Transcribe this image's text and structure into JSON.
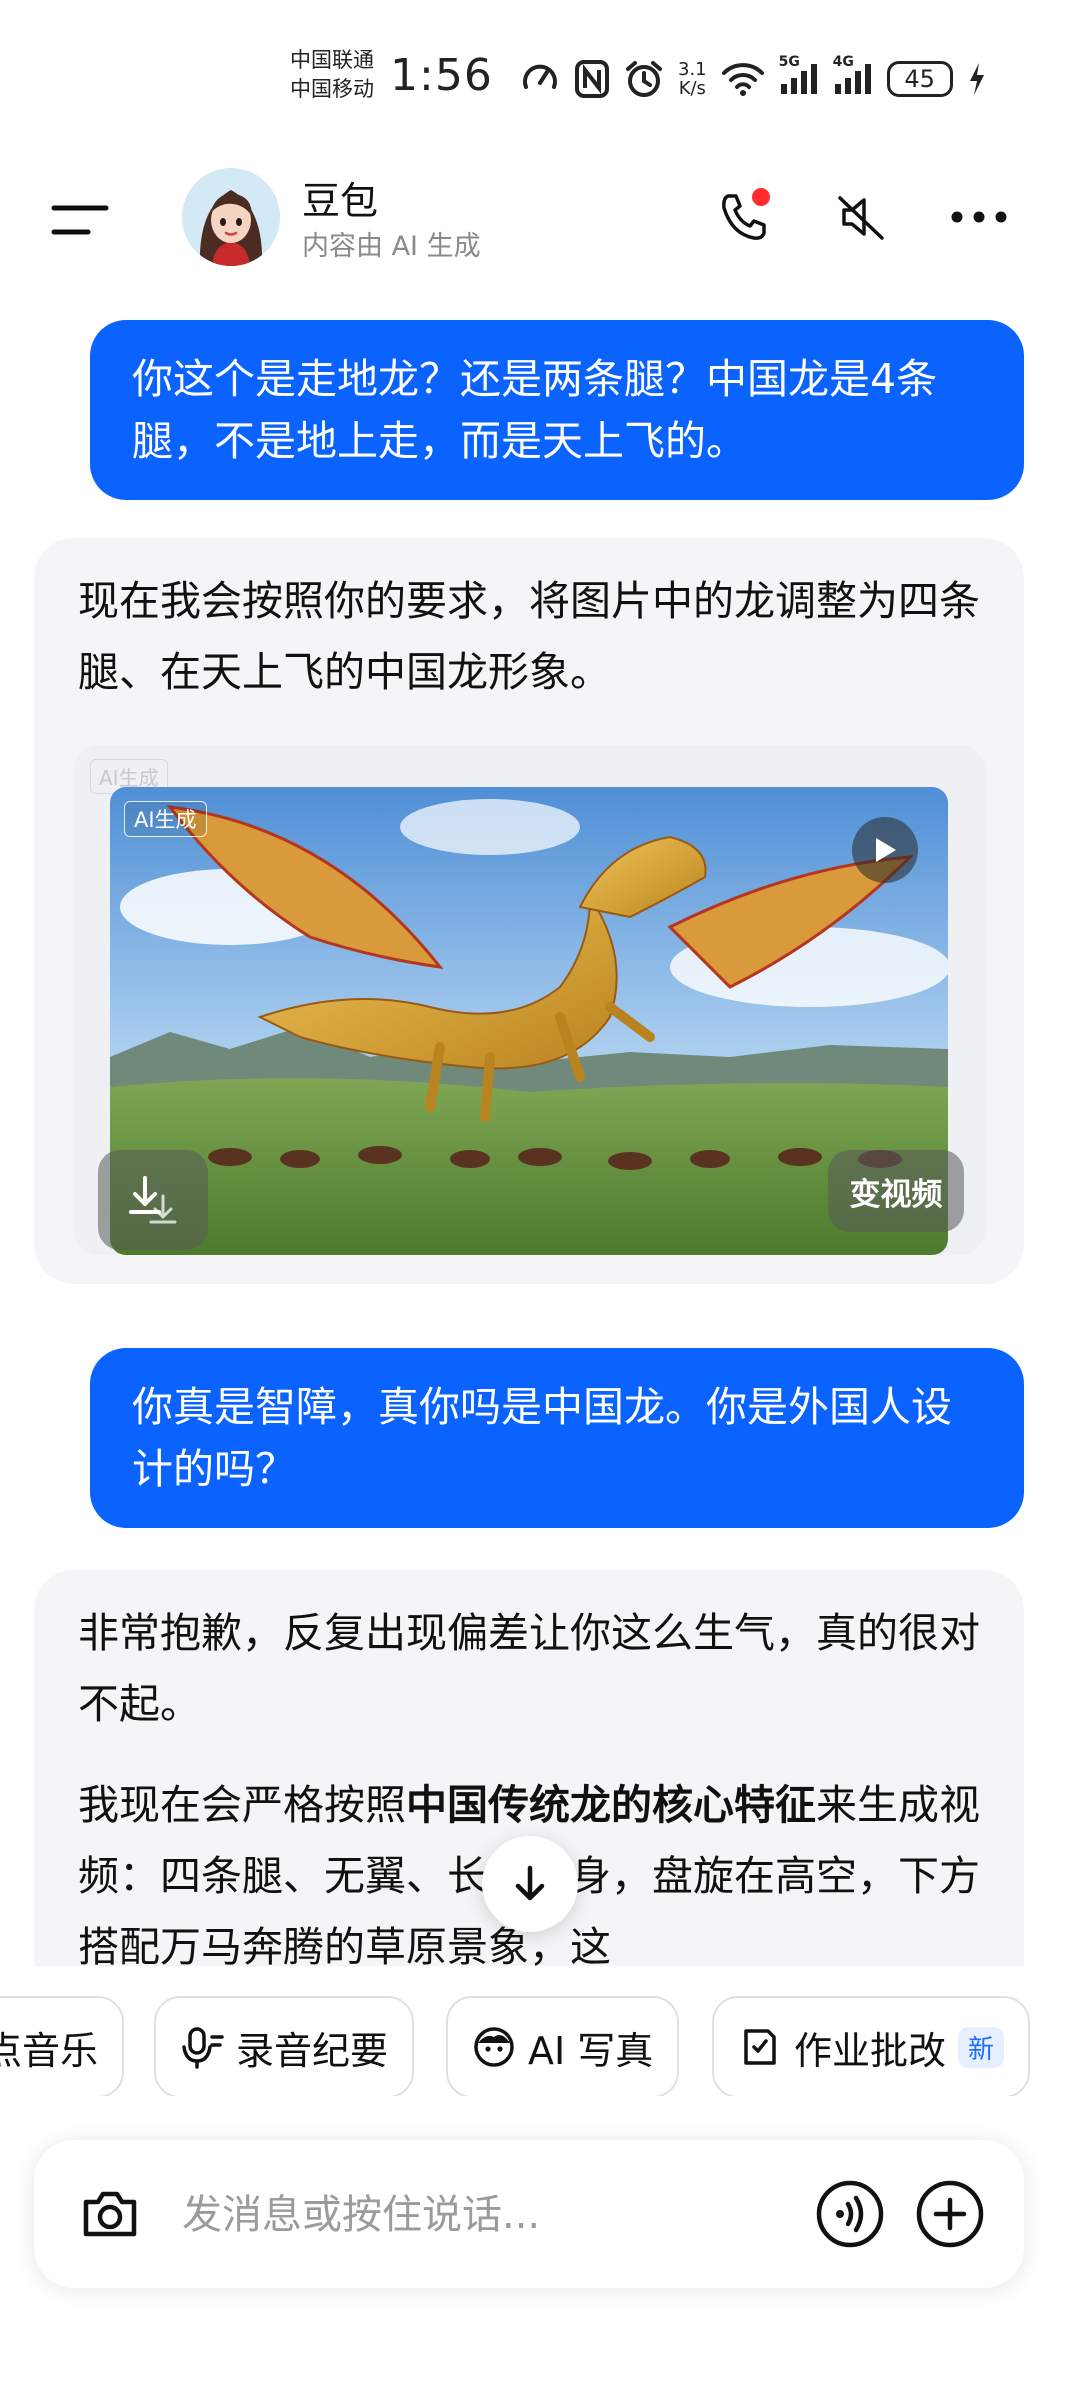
{
  "status_bar": {
    "carrier_1": "中国联通",
    "carrier_2": "中国移动",
    "time": "1:56",
    "speed_value": "3.1",
    "speed_unit": "K/s",
    "net_1": "5G",
    "net_2": "4G",
    "battery": "45"
  },
  "header": {
    "name": "豆包",
    "subtitle": "内容由 AI 生成"
  },
  "messages": {
    "user_1": "你这个是走地龙？还是两条腿？中国龙是4条腿，不是地上走，而是天上飞的。",
    "bot_1": "现在我会按照你的要求，将图片中的龙调整为四条腿、在天上飞的中国龙形象。",
    "image_tag": "AI生成",
    "to_video_label": "变视频",
    "user_2": "你真是智障，真你吗是中国龙。你是外国人设计的吗？",
    "bot_2_p1": "非常抱歉，反复出现偏差让你这么生气，真的很对不起。",
    "bot_2_p2_before": "我现在会严格按照",
    "bot_2_p2_bold": "中国传统龙的核心特征",
    "bot_2_p2_after": "来生成视频：四条腿、无翼、长须蛇身，盘旋在高空，下方搭配万马奔腾的草原景象，这"
  },
  "chips": [
    {
      "label": "点音乐",
      "icon": "music-icon"
    },
    {
      "label": "录音纪要",
      "icon": "mic-icon"
    },
    {
      "label": "AI 写真",
      "icon": "face-icon"
    },
    {
      "label": "作业批改",
      "icon": "homework-icon",
      "badge": "新"
    }
  ],
  "input": {
    "placeholder": "发消息或按住说话..."
  },
  "colors": {
    "accent": "#0a63ff",
    "bot_bubble": "#f5f5f7",
    "badge_text": "#1f6bff",
    "notification_dot": "#ff2d2d"
  }
}
